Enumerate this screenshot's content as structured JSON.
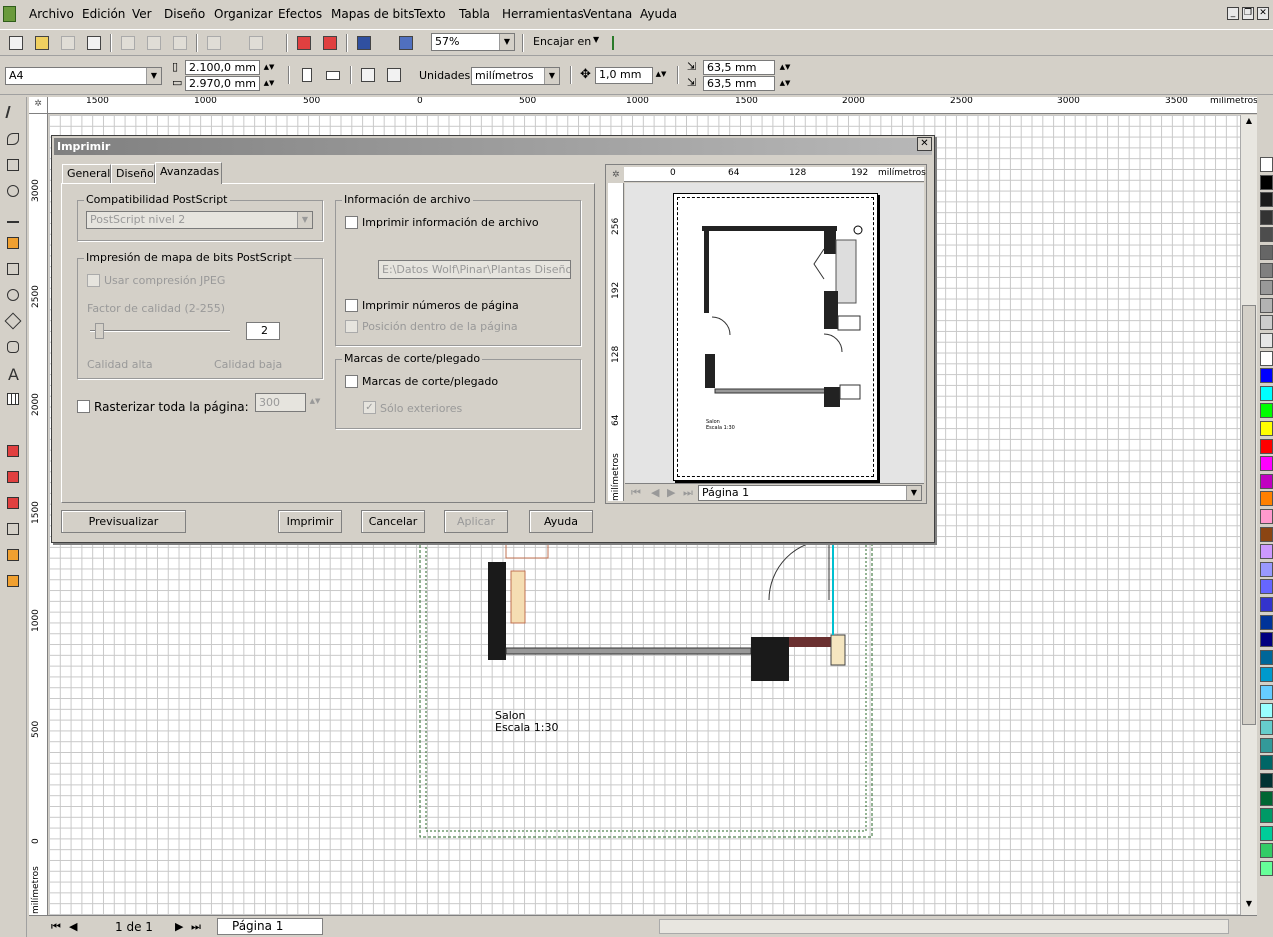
{
  "menu": [
    "Archivo",
    "Edición",
    "Ver",
    "Diseño",
    "Organizar",
    "Efectos",
    "Mapas de bits",
    "Texto",
    "Tabla",
    "Herramientas",
    "Ventana",
    "Ayuda"
  ],
  "toolbar": {
    "zoom": "57%",
    "snap_label": "Encajar en"
  },
  "property_bar": {
    "page_size": "A4",
    "width": "2.100,0 mm",
    "height": "2.970,0 mm",
    "units_label": "Unidades:",
    "units_value": "milímetros",
    "nudge": "1,0 mm",
    "dup_x": "63,5 mm",
    "dup_y": "63,5 mm"
  },
  "ruler": {
    "h_ticks": [
      "1500",
      "1000",
      "500",
      "0",
      "500",
      "1000",
      "1500",
      "2000",
      "2500",
      "3000",
      "3500"
    ],
    "h_unit": "milímetros",
    "v_ticks": [
      "3000",
      "2500",
      "2000",
      "1500",
      "1000",
      "500",
      "0"
    ],
    "v_unit": "milímetros"
  },
  "drawing": {
    "label_line1": "Salon",
    "label_line2": "Escala 1:30"
  },
  "status": {
    "page_count": "1 de 1",
    "page_tab": "Página 1"
  },
  "dialog": {
    "title": "Imprimir",
    "tabs": [
      "General",
      "Diseño",
      "Avanzadas"
    ],
    "active_tab": "Avanzadas",
    "postscript": {
      "group": "Compatibilidad PostScript",
      "value": "PostScript nivel 2"
    },
    "bitmap": {
      "group": "Impresión de mapa de bits PostScript",
      "jpeg_label": "Usar compresión JPEG",
      "quality_label": "Factor de calidad (2-255)",
      "quality_value": "2",
      "high_label": "Calidad alta",
      "low_label": "Calidad baja"
    },
    "rasterize": {
      "label": "Rasterizar toda la página:",
      "value": "300"
    },
    "file_info": {
      "group": "Información de archivo",
      "print_info_label": "Imprimir información de archivo",
      "path": "E:\\Datos Wolf\\Pinar\\Plantas Diseños\\S",
      "page_numbers_label": "Imprimir números de página",
      "position_label": "Posición dentro de la página"
    },
    "crop_marks": {
      "group": "Marcas de corte/plegado",
      "label": "Marcas de corte/plegado",
      "exterior_label": "Sólo exteriores"
    },
    "buttons": {
      "preview": "Previsualizar",
      "print": "Imprimir",
      "cancel": "Cancelar",
      "apply": "Aplicar",
      "help": "Ayuda"
    },
    "preview_pane": {
      "h_ticks": [
        "0",
        "64",
        "128",
        "192"
      ],
      "unit": "milímetros",
      "v_ticks": [
        "256",
        "192",
        "128",
        "64"
      ],
      "page_select": "Página 1",
      "label_line1": "Salon",
      "label_line2": "Escala 1:30"
    }
  },
  "palette_colors": [
    "#ffffff",
    "#000000",
    "#1a1a1a",
    "#333333",
    "#4d4d4d",
    "#666666",
    "#808080",
    "#999999",
    "#b3b3b3",
    "#cccccc",
    "#e6e6e6",
    "#ffffff",
    "#0000ff",
    "#00ffff",
    "#00ff00",
    "#ffff00",
    "#ff0000",
    "#ff00ff",
    "#c000c0",
    "#ff8000",
    "#ff99cc",
    "#8b4513",
    "#cc99ff",
    "#9999ff",
    "#6666ff",
    "#3333cc",
    "#003399",
    "#000080",
    "#006699",
    "#0099cc",
    "#66ccff",
    "#99ffff",
    "#66cccc",
    "#339999",
    "#006666",
    "#003333",
    "#006633",
    "#009966",
    "#00cc99",
    "#33cc66",
    "#66ff99"
  ]
}
